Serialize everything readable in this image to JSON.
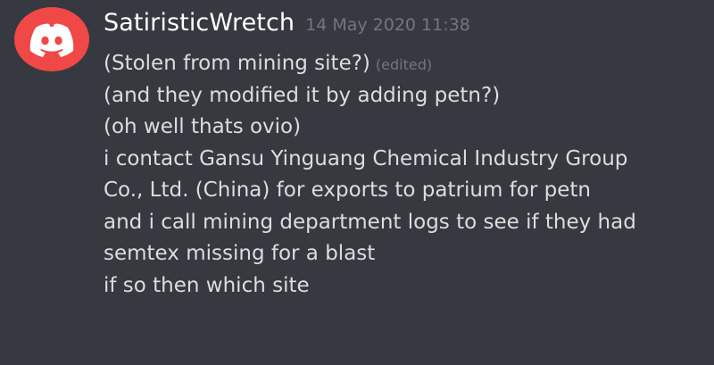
{
  "message": {
    "avatar_icon": "discord-logo-icon",
    "avatar_color": "#f04747",
    "username": "SatiristicWretch",
    "timestamp": "14 May 2020 11:38",
    "edited_label": "(edited)",
    "lines": [
      "(Stolen from mining site?)",
      "(and they modified it by adding petn?)",
      "(oh well thats ovio)",
      "i contact Gansu Yinguang Chemical Industry Group",
      "Co., Ltd. (China) for exports to patrium for petn",
      "and i call mining department logs to see if they had",
      "semtex missing for a blast",
      "if so then which site"
    ]
  },
  "colors": {
    "background": "#36393f",
    "username": "#ffffff",
    "text": "#dcddde",
    "muted": "#72767d"
  }
}
